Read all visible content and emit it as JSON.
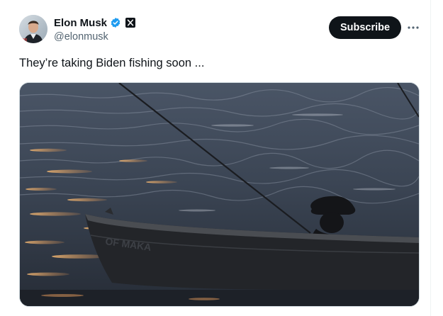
{
  "author": {
    "display_name": "Elon Musk",
    "handle": "@elonmusk",
    "verified_icon": "verified-badge-icon",
    "affiliation_icon": "x-logo-icon"
  },
  "actions": {
    "subscribe_label": "Subscribe",
    "more_icon": "more-horizontal-icon"
  },
  "tweet": {
    "text": "They’re taking Biden fishing soon ..."
  },
  "media": {
    "type": "photo"
  },
  "colors": {
    "verified_blue": "#1d9bf0",
    "text_primary": "#0f1419",
    "text_secondary": "#536471",
    "button_bg": "#0f1419"
  }
}
